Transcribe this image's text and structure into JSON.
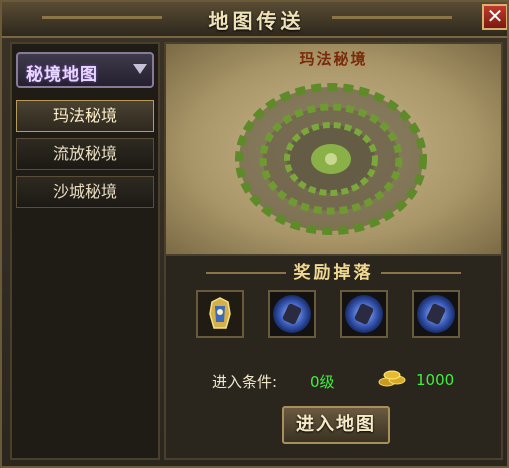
{
  "window": {
    "title": "地图传送",
    "close_symbol": "✕"
  },
  "sidebar": {
    "dropdown_label": "秘境地图",
    "items": [
      {
        "label": "玛法秘境",
        "selected": true
      },
      {
        "label": "流放秘境",
        "selected": false
      },
      {
        "label": "沙城秘境",
        "selected": false
      }
    ]
  },
  "main": {
    "map_name": "玛法秘境",
    "reward_heading": "奖励掉落",
    "rewards": [
      {
        "icon": "armor-item-icon"
      },
      {
        "icon": "blue-orb-item-icon"
      },
      {
        "icon": "blue-orb-item-icon"
      },
      {
        "icon": "blue-orb-item-icon"
      }
    ],
    "condition_label": "进入条件:",
    "condition_level": "0级",
    "gold_amount": "1000",
    "enter_button": "进入地图"
  },
  "colors": {
    "accent_gold": "#f0d890",
    "value_green": "#3ef03e",
    "close_red": "#c0392b"
  }
}
